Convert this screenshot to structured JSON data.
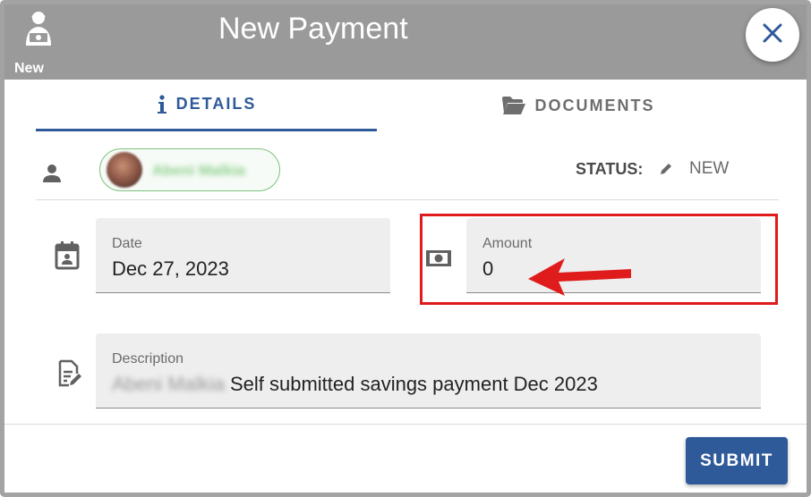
{
  "header": {
    "title": "New Payment",
    "user_badge_label": "New",
    "user_icon": "user-money-icon",
    "close_icon": "close-icon"
  },
  "tabs": [
    {
      "label": "DETAILS",
      "icon": "info-icon",
      "active": true
    },
    {
      "label": "DOCUMENTS",
      "icon": "folder-open-icon",
      "active": false
    }
  ],
  "person": {
    "icon": "person-icon",
    "name": "Abeni Malkia"
  },
  "status": {
    "label": "STATUS:",
    "value": "NEW",
    "edit_icon": "pencil-icon"
  },
  "fields": {
    "date": {
      "label": "Date",
      "value": "Dec 27, 2023",
      "icon": "calendar-icon"
    },
    "amount": {
      "label": "Amount",
      "value": "0",
      "icon": "cash-icon"
    },
    "description": {
      "label": "Description",
      "blurred_prefix": "Abeni Malkia",
      "value": "Self submitted savings payment Dec 2023",
      "icon": "note-edit-icon"
    }
  },
  "footer": {
    "submit_label": "SUBMIT"
  },
  "colors": {
    "accent": "#2f5a9a",
    "header_bg": "#9a9a9a",
    "highlight": "#e01b1b",
    "chip_border": "#7cc27c"
  }
}
